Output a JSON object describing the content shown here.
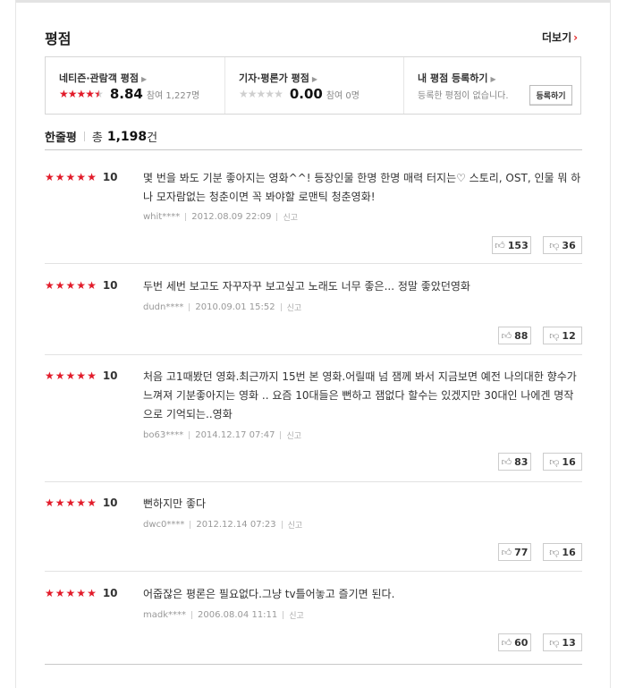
{
  "header": {
    "title": "평점",
    "more_label": "더보기",
    "more_arrow": "›"
  },
  "scores": {
    "netizen": {
      "title": "네티즌·관람객 평점",
      "score": "8.84",
      "participants": "참여 1,227명",
      "rating_out_of_10": 8.84
    },
    "critic": {
      "title": "기자·평론가 평점",
      "score": "0.00",
      "participants": "참여 0명",
      "rating_out_of_10": 0
    },
    "mine": {
      "title": "내 평점 등록하기",
      "note": "등록한 평점이 없습니다.",
      "button_label": "등록하기"
    }
  },
  "summary": {
    "title": "한줄평",
    "total_prefix": "총",
    "count": "1,198",
    "unit": "건"
  },
  "reviews": [
    {
      "stars": 5,
      "score": "10",
      "text": "몇 번을 봐도 기분 좋아지는 영화^^! 등장인물 한명 한명 매력 터지는♡ 스토리, OST, 인물 뭐 하나 모자람없는 청춘이면 꼭 봐야할 로맨틱 청춘영화!",
      "user": "whit****",
      "date": "2012.08.09 22:09",
      "report": "신고",
      "likes": "153",
      "dislikes": "36"
    },
    {
      "stars": 5,
      "score": "10",
      "text": "두번 세번 보고도 자꾸자꾸 보고싶고 노래도 너무 좋은... 정말 좋았던영화",
      "user": "dudn****",
      "date": "2010.09.01 15:52",
      "report": "신고",
      "likes": "88",
      "dislikes": "12"
    },
    {
      "stars": 5,
      "score": "10",
      "text": "처음 고1때봤던 영화.최근까지 15번 본 영화.어릴때 넘 잼께 봐서 지금보면 예전 나의대한 향수가 느껴져 기분좋아지는 영화 .. 요즘 10대들은 뻔하고 잼없다 할수는 있겠지만 30대인 나에겐 명작으로 기억되는..영화",
      "user": "bo63****",
      "date": "2014.12.17 07:47",
      "report": "신고",
      "likes": "83",
      "dislikes": "16"
    },
    {
      "stars": 5,
      "score": "10",
      "text": "뻔하지만 좋다",
      "user": "dwc0****",
      "date": "2012.12.14 07:23",
      "report": "신고",
      "likes": "77",
      "dislikes": "16"
    },
    {
      "stars": 5,
      "score": "10",
      "text": "어줍잖은 평론은 필요없다.그냥 tv틀어놓고 즐기면 된다.",
      "user": "madk****",
      "date": "2006.08.04 11:11",
      "report": "신고",
      "likes": "60",
      "dislikes": "13"
    }
  ],
  "icons": {
    "thumb_up": "thumbs-up-icon",
    "thumb_down": "thumbs-down-icon",
    "star": "star-icon",
    "caret": "caret-right-icon"
  },
  "colors": {
    "accent_red": "#e21b2a",
    "star_off": "#cfcfcf"
  }
}
